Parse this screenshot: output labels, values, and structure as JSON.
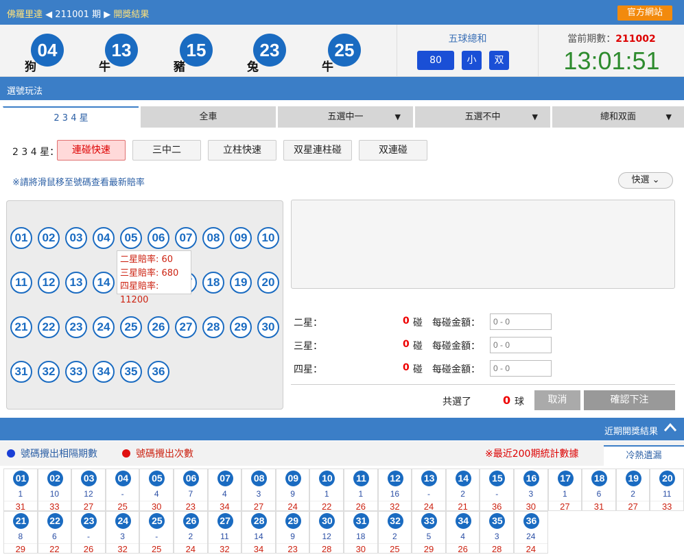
{
  "topbar": {
    "site": "佛羅里達",
    "prev_arrow": "◀",
    "issue": "211001",
    "issue_suffix": "期",
    "next_arrow": "▶",
    "section": "開獎結果",
    "official_btn": "官方網站"
  },
  "draw": {
    "balls": [
      {
        "num": "04",
        "zodiac": "狗"
      },
      {
        "num": "13",
        "zodiac": "牛"
      },
      {
        "num": "15",
        "zodiac": "豬"
      },
      {
        "num": "23",
        "zodiac": "兔"
      },
      {
        "num": "25",
        "zodiac": "牛"
      }
    ],
    "sum_title": "五球總和",
    "sum_value": "80",
    "sum_size": "小",
    "sum_parity": "双",
    "current_label": "當前期數：",
    "current_issue": "211002",
    "clock": "13:01:51"
  },
  "play": {
    "header": "選號玩法",
    "tabs": [
      {
        "label": "2 3 4 星",
        "arrow": ""
      },
      {
        "label": "全車",
        "arrow": ""
      },
      {
        "label": "五選中一",
        "arrow": "▼"
      },
      {
        "label": "五選不中",
        "arrow": "▼"
      },
      {
        "label": "總和双面",
        "arrow": "▼"
      }
    ],
    "sub_label": "2 3 4 星：",
    "sub_buttons": [
      "連碰快速",
      "三中二",
      "立柱快速",
      "双星連柱碰",
      "双連碰"
    ],
    "hint": "※請將滑鼠移至號碼查看最新賠率",
    "quick_pick": "快選",
    "quick_arrow": "⌄",
    "numbers": [
      "01",
      "02",
      "03",
      "04",
      "05",
      "06",
      "07",
      "08",
      "09",
      "10",
      "11",
      "12",
      "13",
      "14",
      "15",
      "16",
      "17",
      "18",
      "19",
      "20",
      "21",
      "22",
      "23",
      "24",
      "25",
      "26",
      "27",
      "28",
      "29",
      "30",
      "31",
      "32",
      "33",
      "34",
      "35",
      "36"
    ],
    "tooltip": {
      "line1": "二星賠率: 60",
      "line2": "三星賠率: 680",
      "line3": "四星賠率: 11200"
    },
    "odds_rows": [
      {
        "label": "二星：",
        "count": "0",
        "unit": "碰",
        "money_label": "每碰金額：",
        "placeholder": "0 - 0"
      },
      {
        "label": "三星：",
        "count": "0",
        "unit": "碰",
        "money_label": "每碰金額：",
        "placeholder": "0 - 0"
      },
      {
        "label": "四星：",
        "count": "0",
        "unit": "碰",
        "money_label": "每碰金額：",
        "placeholder": "0 - 0"
      }
    ],
    "total_label": "共選了",
    "total_count": "0",
    "total_unit": "球",
    "cancel": "取消",
    "confirm": "確認下注"
  },
  "recent": {
    "header": "近期開獎結果",
    "collapse_icon": "︿",
    "legend_gap": "號碼攪出相隔期數",
    "legend_count": "號碼攪出次數",
    "stat_note": "※最近200期統計數據",
    "cold_tab": "冷熱遺漏",
    "colors": {
      "gap": "#1a3fd6",
      "count": "#e01010"
    },
    "stats": [
      {
        "num": "01",
        "gap": "1",
        "count": "31"
      },
      {
        "num": "02",
        "gap": "10",
        "count": "33"
      },
      {
        "num": "03",
        "gap": "12",
        "count": "27"
      },
      {
        "num": "04",
        "gap": "-",
        "count": "25"
      },
      {
        "num": "05",
        "gap": "4",
        "count": "30"
      },
      {
        "num": "06",
        "gap": "7",
        "count": "23"
      },
      {
        "num": "07",
        "gap": "4",
        "count": "34"
      },
      {
        "num": "08",
        "gap": "3",
        "count": "27"
      },
      {
        "num": "09",
        "gap": "9",
        "count": "24"
      },
      {
        "num": "10",
        "gap": "1",
        "count": "22"
      },
      {
        "num": "11",
        "gap": "1",
        "count": "26"
      },
      {
        "num": "12",
        "gap": "16",
        "count": "32"
      },
      {
        "num": "13",
        "gap": "-",
        "count": "24"
      },
      {
        "num": "14",
        "gap": "2",
        "count": "21"
      },
      {
        "num": "15",
        "gap": "-",
        "count": "36"
      },
      {
        "num": "16",
        "gap": "3",
        "count": "30"
      },
      {
        "num": "17",
        "gap": "1",
        "count": "27"
      },
      {
        "num": "18",
        "gap": "6",
        "count": "31"
      },
      {
        "num": "19",
        "gap": "2",
        "count": "27"
      },
      {
        "num": "20",
        "gap": "11",
        "count": "33"
      },
      {
        "num": "21",
        "gap": "8",
        "count": "29"
      },
      {
        "num": "22",
        "gap": "6",
        "count": "22"
      },
      {
        "num": "23",
        "gap": "-",
        "count": "26"
      },
      {
        "num": "24",
        "gap": "3",
        "count": "32"
      },
      {
        "num": "25",
        "gap": "-",
        "count": "25"
      },
      {
        "num": "26",
        "gap": "2",
        "count": "24"
      },
      {
        "num": "27",
        "gap": "11",
        "count": "32"
      },
      {
        "num": "28",
        "gap": "14",
        "count": "34"
      },
      {
        "num": "29",
        "gap": "9",
        "count": "23"
      },
      {
        "num": "30",
        "gap": "12",
        "count": "28"
      },
      {
        "num": "31",
        "gap": "18",
        "count": "30"
      },
      {
        "num": "32",
        "gap": "2",
        "count": "25"
      },
      {
        "num": "33",
        "gap": "5",
        "count": "29"
      },
      {
        "num": "34",
        "gap": "4",
        "count": "26"
      },
      {
        "num": "35",
        "gap": "3",
        "count": "28"
      },
      {
        "num": "36",
        "gap": "24",
        "count": "24"
      }
    ]
  }
}
